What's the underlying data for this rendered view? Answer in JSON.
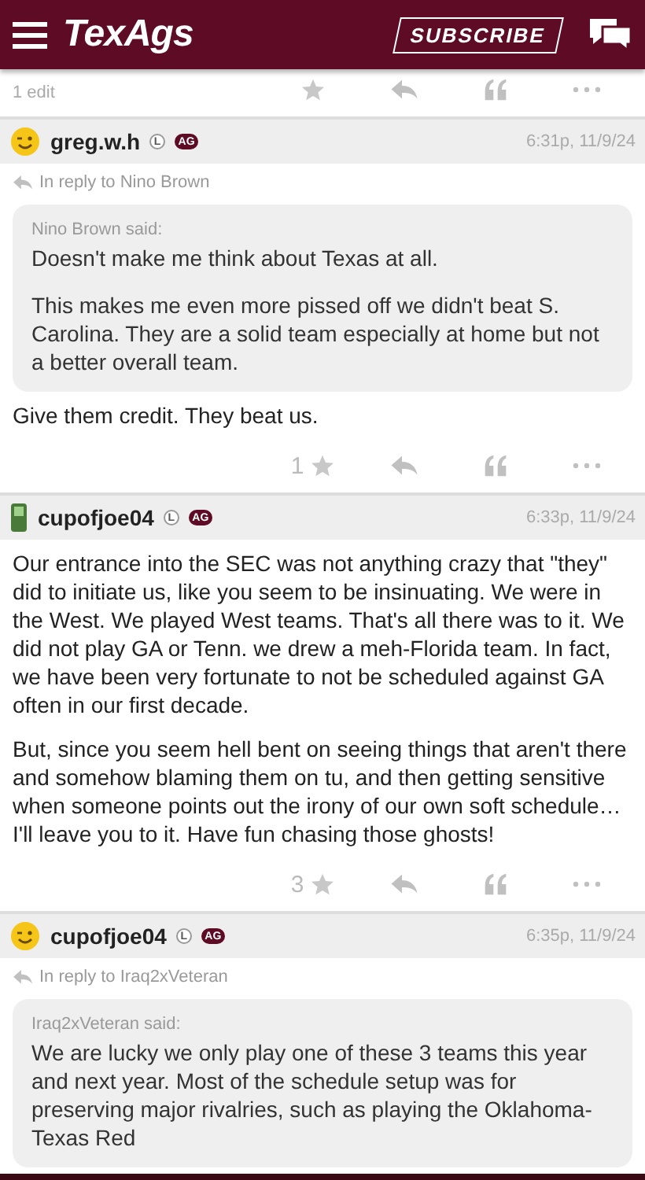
{
  "header": {
    "logo": "TexAgs",
    "subscribe": "SUBSCRIBE"
  },
  "top_fragment": {
    "edit_note": "1 edit"
  },
  "posts": [
    {
      "kind": "wink",
      "username": "greg.w.h",
      "badges": [
        {
          "label": "L",
          "kind": "outline"
        },
        {
          "label": "AG",
          "kind": "filled"
        }
      ],
      "time": "6:31p, 11/9/24",
      "reply_to": "In reply to Nino Brown",
      "quote": {
        "author": "Nino Brown said:",
        "paragraphs": [
          "Doesn't make me think about Texas at all.",
          "This makes me even more pissed off we didn't beat S. Carolina. They are a solid team especially at home but not a better overall team."
        ]
      },
      "paragraphs": [
        "Give them credit. They beat us."
      ],
      "like_count": "1"
    },
    {
      "kind": "phone",
      "username": "cupofjoe04",
      "badges": [
        {
          "label": "L",
          "kind": "outline"
        },
        {
          "label": "AG",
          "kind": "filled"
        }
      ],
      "time": "6:33p, 11/9/24",
      "paragraphs": [
        "Our entrance into the SEC was not anything crazy that \"they\" did to initiate us, like you seem to be insinuating. We were in the West. We played West teams. That's all there was to it. We did not play GA or Tenn. we drew a meh-Florida team. In fact, we have been very fortunate to not be scheduled against GA often in our first decade.",
        "But, since you seem hell bent on seeing things that aren't there and somehow blaming them on tu, and then getting sensitive when someone points out the irony of our own soft schedule… I'll leave you to it. Have fun chasing those ghosts!"
      ],
      "like_count": "3"
    },
    {
      "kind": "wink",
      "username": "cupofjoe04",
      "badges": [
        {
          "label": "L",
          "kind": "outline"
        },
        {
          "label": "AG",
          "kind": "filled"
        }
      ],
      "time": "6:35p, 11/9/24",
      "reply_to": "In reply to Iraq2xVeteran",
      "quote": {
        "author": "Iraq2xVeteran said:",
        "paragraphs": [
          "We are lucky we only play one of these 3 teams this year and next year. Most of the schedule setup was for preserving major rivalries, such as playing the Oklahoma-Texas Red"
        ]
      }
    }
  ]
}
